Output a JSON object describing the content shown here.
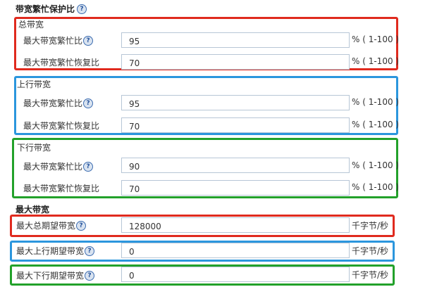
{
  "title": "带宽繁忙保护比",
  "help_glyph": "?",
  "sections": {
    "total": {
      "title": "总带宽",
      "max_busy_label": "最大带宽繁忙比",
      "max_busy_value": "95",
      "max_busy_unit": "% ( 1-100 )",
      "recover_label": "最大带宽繁忙恢复比",
      "recover_value": "70",
      "recover_unit": "% ( 1-100 )"
    },
    "upstream": {
      "title": "上行带宽",
      "max_busy_label": "最大带宽繁忙比",
      "max_busy_value": "95",
      "max_busy_unit": "% ( 1-100 )",
      "recover_label": "最大带宽繁忙恢复比",
      "recover_value": "70",
      "recover_unit": "% ( 1-100 )"
    },
    "downstream": {
      "title": "下行带宽",
      "max_busy_label": "最大带宽繁忙比",
      "max_busy_value": "90",
      "max_busy_unit": "% ( 1-100 )",
      "recover_label": "最大带宽繁忙恢复比",
      "recover_value": "70",
      "recover_unit": "% ( 1-100 )"
    }
  },
  "max_bandwidth": {
    "title": "最大带宽",
    "total": {
      "label": "最大总期望带宽",
      "value": "128000",
      "unit": "千字节/秒"
    },
    "upload": {
      "label": "最大上行期望带宽",
      "value": "0",
      "unit": "千字节/秒"
    },
    "download": {
      "label": "最大下行期望带宽",
      "value": "0",
      "unit": "千字节/秒"
    }
  },
  "colors": {
    "red": "#e02a1e",
    "blue": "#2b96dd",
    "green": "#22a12a"
  }
}
